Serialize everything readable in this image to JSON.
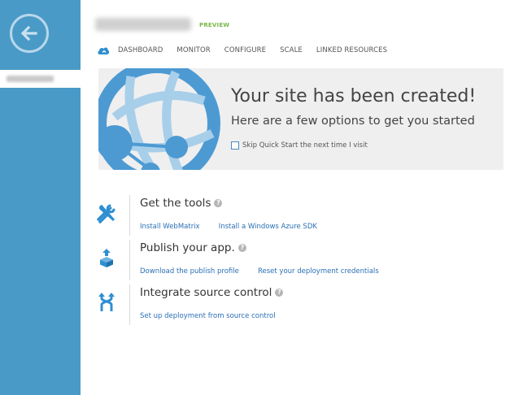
{
  "header": {
    "preview_badge": "PREVIEW"
  },
  "nav": {
    "tabs": [
      {
        "label": "DASHBOARD"
      },
      {
        "label": "MONITOR"
      },
      {
        "label": "CONFIGURE"
      },
      {
        "label": "SCALE"
      },
      {
        "label": "LINKED RESOURCES"
      }
    ]
  },
  "banner": {
    "title": "Your site has been created!",
    "subtitle": "Here are a few options to get you started",
    "skip_label": "Skip Quick Start the next time I visit",
    "skip_checked": false
  },
  "options": [
    {
      "title": "Get the tools",
      "icon": "tools-icon",
      "links": [
        "Install WebMatrix",
        "Install a Windows Azure SDK"
      ]
    },
    {
      "title": "Publish your app.",
      "icon": "publish-icon",
      "links": [
        "Download the publish profile",
        "Reset your deployment credentials"
      ]
    },
    {
      "title": "Integrate source control",
      "icon": "source-control-icon",
      "links": [
        "Set up deployment from source control"
      ]
    }
  ],
  "colors": {
    "sidebar": "#4a9ac7",
    "accent_blue": "#2a6fb5",
    "icon_blue": "#2e8fd0",
    "preview_green": "#7ab648",
    "banner_bg": "#efefef"
  }
}
